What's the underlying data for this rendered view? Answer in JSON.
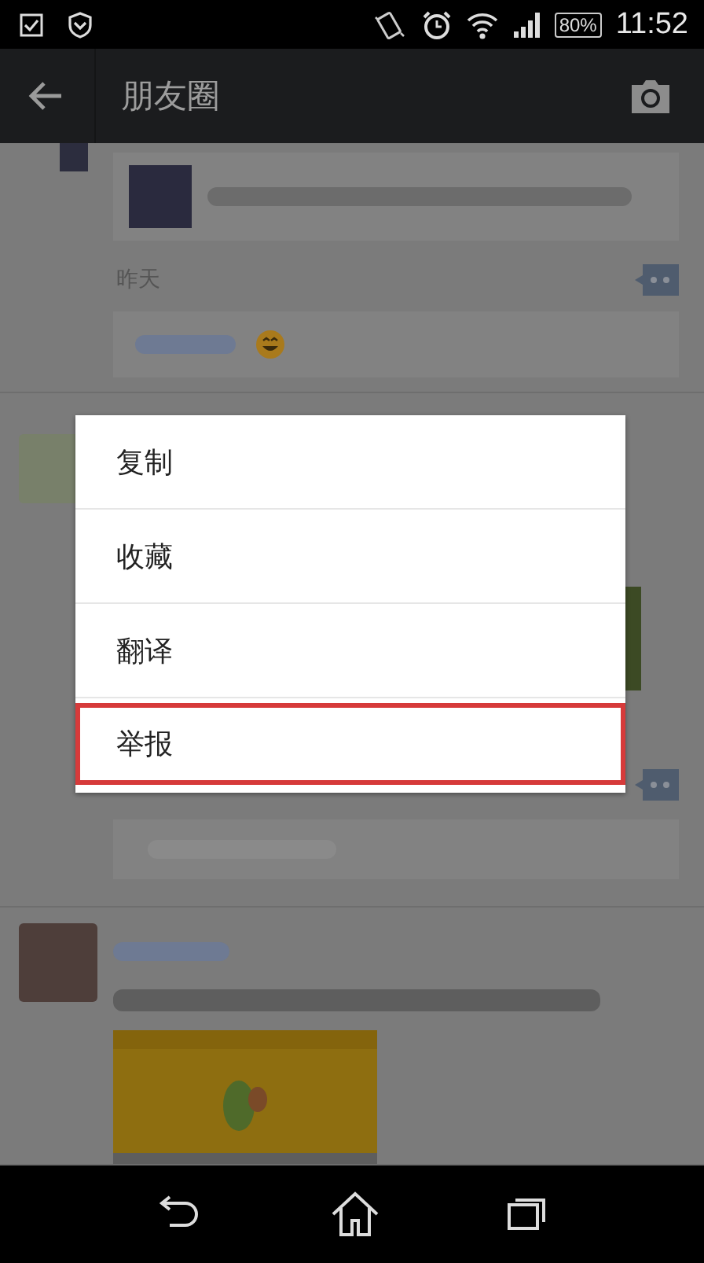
{
  "status_bar": {
    "battery": "80%",
    "time": "11:52"
  },
  "app_bar": {
    "title": "朋友圈"
  },
  "feed": {
    "first_post": {
      "timestamp": "昨天"
    }
  },
  "context_menu": {
    "items": [
      {
        "label": "复制",
        "selected": false
      },
      {
        "label": "收藏",
        "selected": false
      },
      {
        "label": "翻译",
        "selected": false
      },
      {
        "label": "举报",
        "selected": true
      }
    ]
  }
}
